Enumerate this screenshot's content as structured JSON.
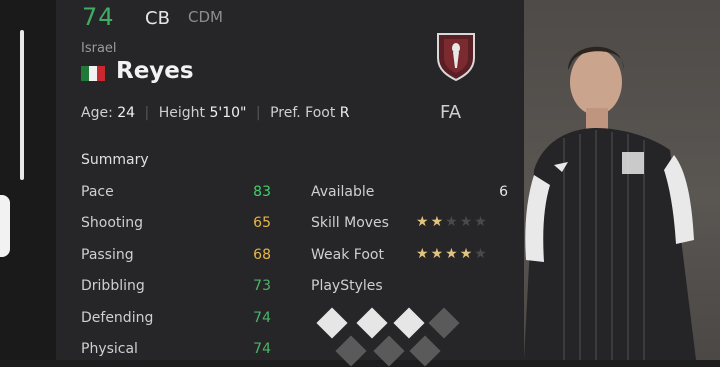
{
  "player": {
    "overall": "74",
    "positions": [
      "CB",
      "CDM"
    ],
    "nation": "Israel",
    "name": "Reyes",
    "age_label": "Age:",
    "age": "24",
    "height_label": "Height",
    "height": "5'10\"",
    "foot_label": "Pref. Foot",
    "foot": "R",
    "club_abbr": "FA"
  },
  "summary": {
    "title": "Summary",
    "stats": [
      {
        "label": "Pace",
        "value": "83",
        "color": "#3fd06a"
      },
      {
        "label": "Shooting",
        "value": "65",
        "color": "#e7b54a"
      },
      {
        "label": "Passing",
        "value": "68",
        "color": "#e7b54a"
      },
      {
        "label": "Dribbling",
        "value": "73",
        "color": "#4bb567"
      },
      {
        "label": "Defending",
        "value": "74",
        "color": "#4bb567"
      },
      {
        "label": "Physical",
        "value": "74",
        "color": "#4bb567"
      }
    ]
  },
  "info": {
    "available_label": "Available",
    "available_value": "6",
    "skill_label": "Skill Moves",
    "skill_stars": 2,
    "weak_label": "Weak Foot",
    "weak_stars": 4,
    "playstyles_label": "PlayStyles"
  },
  "colors": {
    "ovr": "#3fae63",
    "star_on": "#e3c47f",
    "star_off": "#4a4a4a"
  }
}
